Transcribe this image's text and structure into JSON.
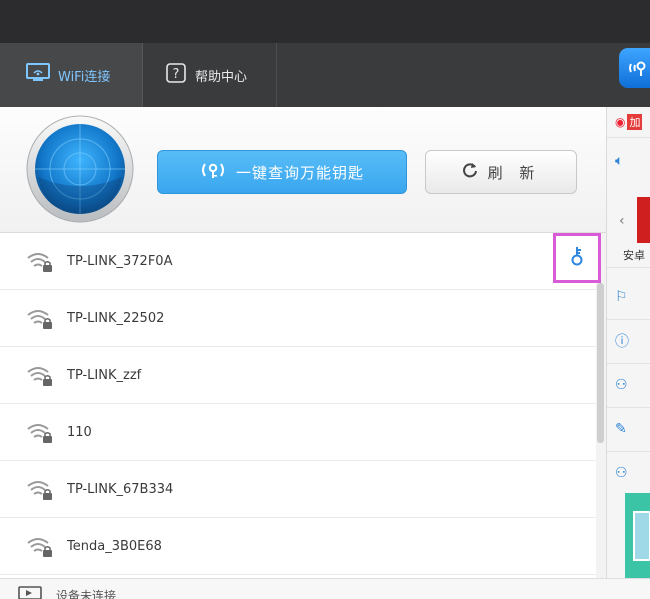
{
  "top_tabs": [
    {
      "label": "WiFi连接",
      "icon": "monitor-wifi-icon",
      "active": true
    },
    {
      "label": "帮助中心",
      "icon": "help-icon",
      "active": false
    }
  ],
  "actions": {
    "find_key_label": "一键查询万能钥匙",
    "refresh_label": "刷 新"
  },
  "networks": [
    {
      "name": "TP-LINK_372F0A",
      "key_available": true
    },
    {
      "name": "TP-LINK_22502",
      "key_available": false
    },
    {
      "name": "TP-LINK_zzf",
      "key_available": false
    },
    {
      "name": "110",
      "key_available": false
    },
    {
      "name": "TP-LINK_67B334",
      "key_available": false
    },
    {
      "name": "Tenda_3B0E68",
      "key_available": false
    }
  ],
  "bottom": {
    "label": "设备未连接"
  },
  "side": {
    "badge": "加",
    "promo_label": "安卓",
    "icons": [
      "volume-icon",
      "flag-icon",
      "info-icon",
      "user-icon",
      "edit-icon",
      "user-v-icon"
    ]
  },
  "colors": {
    "accent": "#3aa6ef",
    "highlight": "#d95bd8",
    "topbar": "#3a3b3d"
  }
}
